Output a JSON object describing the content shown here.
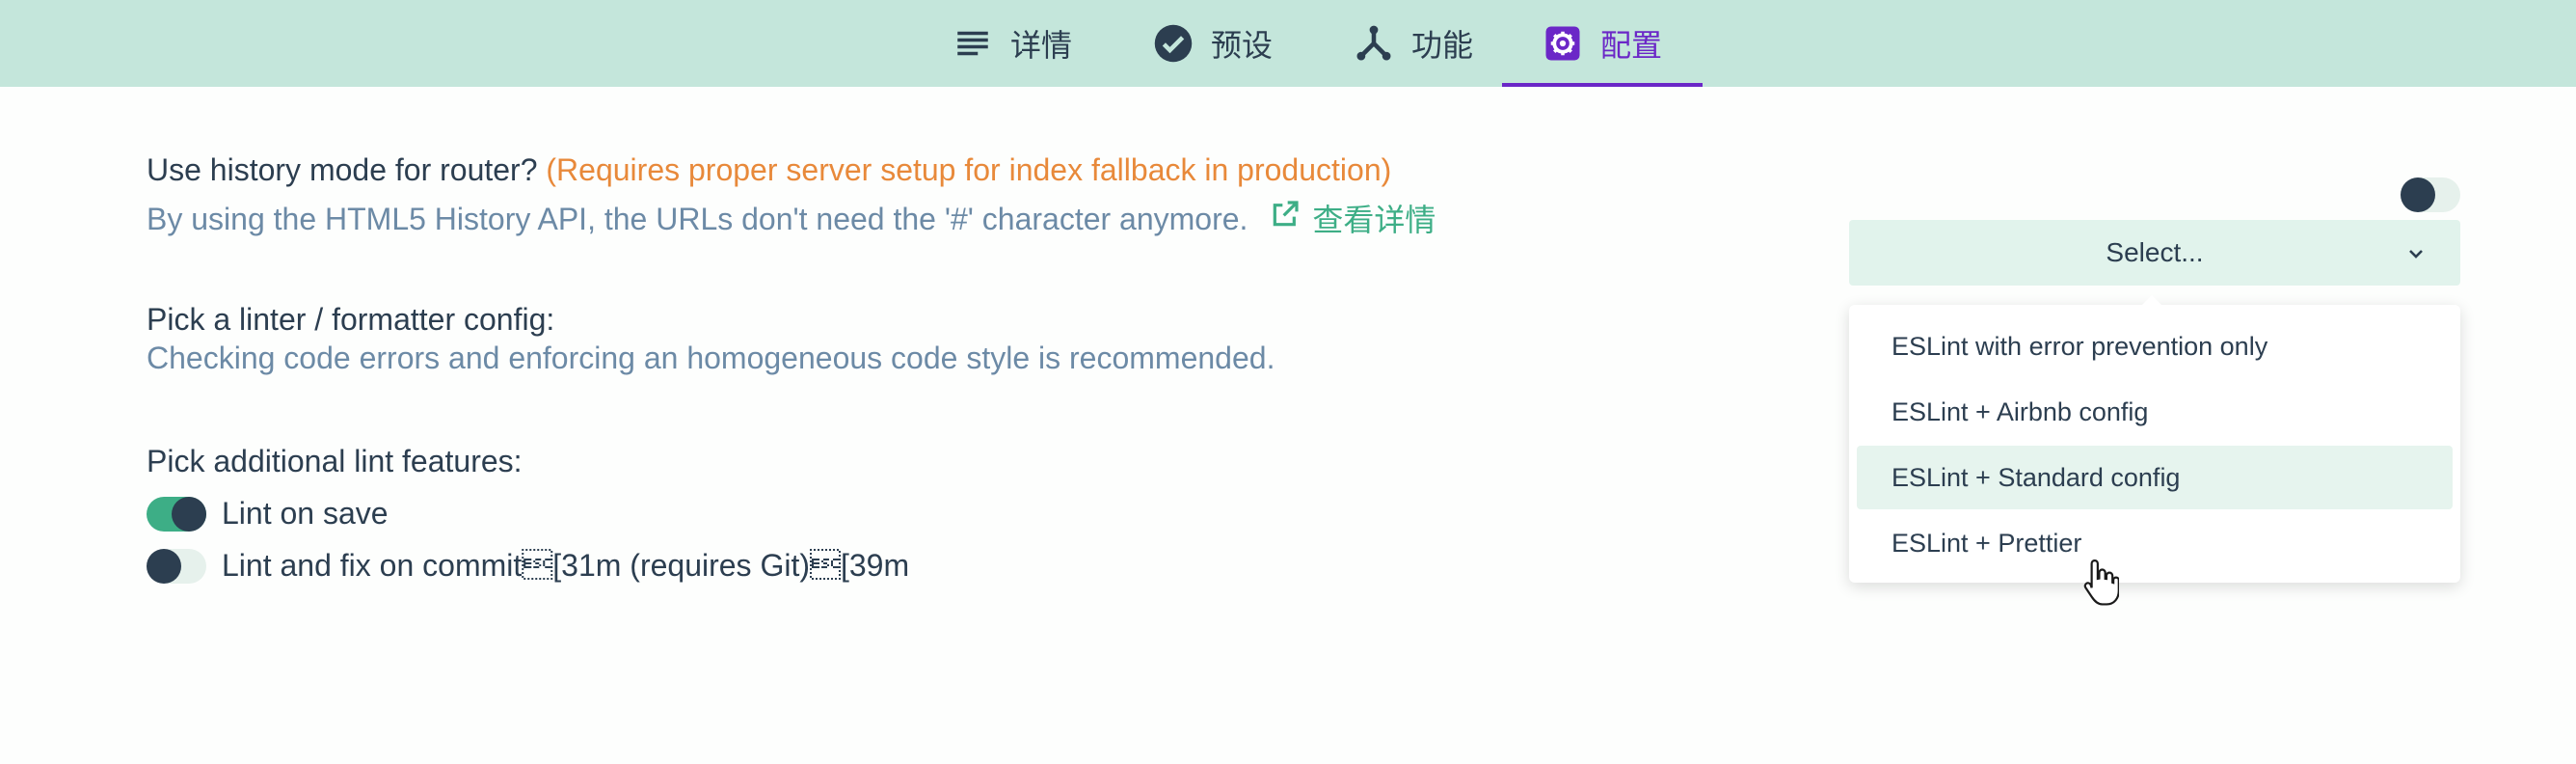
{
  "tabs": [
    {
      "label": "详情",
      "icon": "list-icon",
      "active": false
    },
    {
      "label": "预设",
      "icon": "check-circle-icon",
      "active": false
    },
    {
      "label": "功能",
      "icon": "fork-icon",
      "active": false
    },
    {
      "label": "配置",
      "icon": "gear-icon",
      "active": true
    }
  ],
  "router": {
    "title": "Use history mode for router?",
    "warning": "(Requires proper server setup for index fallback in production)",
    "description": "By using the HTML5 History API, the URLs don't need the '#' character anymore.",
    "more_label": "查看详情",
    "enabled": false
  },
  "linter": {
    "title": "Pick a linter / formatter config:",
    "description": "Checking code errors and enforcing an homogeneous code style is recommended.",
    "select_placeholder": "Select...",
    "options": [
      "ESLint with error prevention only",
      "ESLint + Airbnb config",
      "ESLint + Standard config",
      "ESLint + Prettier"
    ],
    "hovered_option": "ESLint + Standard config"
  },
  "lint_features": {
    "title": "Pick additional lint features:",
    "items": [
      {
        "label": "Lint on save",
        "enabled": true
      },
      {
        "label": "Lint and fix on commit\u001b[31m (requires Git)\u001b[39m",
        "enabled": false
      }
    ]
  },
  "colors": {
    "tabbar_bg": "#c4e6db",
    "accent_active": "#6b27c7",
    "warning": "#e8893a",
    "link": "#3dae86",
    "description": "#6c8aa6"
  }
}
